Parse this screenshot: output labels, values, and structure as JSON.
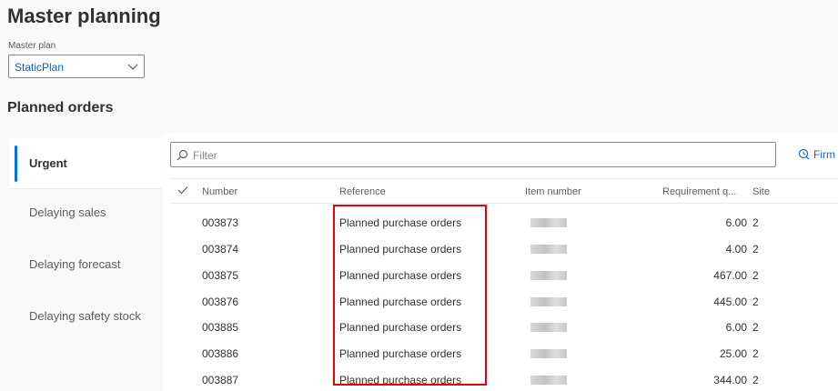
{
  "page": {
    "title": "Master planning"
  },
  "master_plan": {
    "label": "Master plan",
    "value": "StaticPlan"
  },
  "section": {
    "title": "Planned orders"
  },
  "nav": {
    "items": [
      {
        "label": "Urgent"
      },
      {
        "label": "Delaying sales"
      },
      {
        "label": "Delaying forecast"
      },
      {
        "label": "Delaying safety stock"
      }
    ]
  },
  "filter": {
    "placeholder": "Filter"
  },
  "toolbar": {
    "firm_label": "Firm"
  },
  "grid": {
    "headers": [
      "Number",
      "Reference",
      "Item number",
      "Requirement q...",
      "Site"
    ],
    "rows": [
      {
        "number": "003873",
        "reference": "Planned purchase orders",
        "qty": "6.00",
        "site": "2"
      },
      {
        "number": "003874",
        "reference": "Planned purchase orders",
        "qty": "4.00",
        "site": "2"
      },
      {
        "number": "003875",
        "reference": "Planned purchase orders",
        "qty": "467.00",
        "site": "2"
      },
      {
        "number": "003876",
        "reference": "Planned purchase orders",
        "qty": "445.00",
        "site": "2"
      },
      {
        "number": "003885",
        "reference": "Planned purchase orders",
        "qty": "6.00",
        "site": "2"
      },
      {
        "number": "003886",
        "reference": "Planned purchase orders",
        "qty": "25.00",
        "site": "2"
      },
      {
        "number": "003887",
        "reference": "Planned purchase orders",
        "qty": "344.00",
        "site": "2"
      }
    ]
  },
  "colors": {
    "accent": "#0078d4",
    "highlight": "#e3000f",
    "link": "#0f6cbd"
  }
}
